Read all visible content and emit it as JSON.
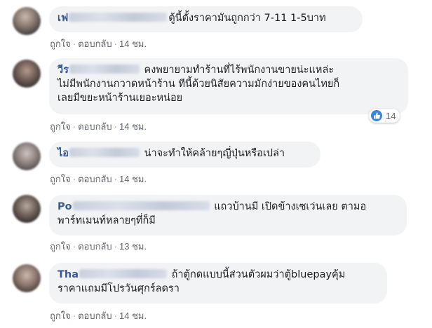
{
  "comments": [
    {
      "name_visible": "เฟ",
      "text_line1": "ตู้นี้ตั้งราคามันถูกกว่า 7-11 1-5บาท",
      "text_line2": "",
      "text_line3": "",
      "like": "ถูกใจ",
      "dot": "·",
      "reply": "ตอบกลับ",
      "time": "14 ชม."
    },
    {
      "name_visible": "วีร",
      "text_line1": "คงพยายามทำร้านที่ไร้พนักงานขายน่ะแหล่ะ",
      "text_line2": "ไม่มีพนักงานกวาดหน้าร้าน ทีนี้ด้วยนิสัยความมักง่ายของคนไทยก็",
      "text_line3": "เลยมีขยะหน้าร้านเยอะหน่อย",
      "like": "ถูกใจ",
      "dot": "·",
      "reply": "ตอบกลับ",
      "time": "14 ชม.",
      "reaction_count": "14",
      "reaction_icon": "thumbs-up-icon"
    },
    {
      "name_visible": "ไอ",
      "text_line1": "น่าจะทำให้คล้ายๆญี่ปุ่นหรือเปล่า",
      "text_line2": "",
      "text_line3": "",
      "like": "ถูกใจ",
      "dot": "·",
      "reply": "ตอบกลับ",
      "time": "14 ชม."
    },
    {
      "name_visible": "Po",
      "text_line1": "แถวบ้านมี เปิดข้างเซเว่นเลย ตามอ",
      "text_line2": "พาร์ทเมนท์หลายๆที่ก็มี",
      "text_line3": "",
      "like": "ถูกใจ",
      "dot": "·",
      "reply": "ตอบกลับ",
      "time": "13 ชม."
    },
    {
      "name_visible": "Tha",
      "text_line1": "ถ้าตู้กดแบบนี้ส่วนตัวผมว่าตู้bluepayคุ้ม",
      "text_line2": "ราคาแถมมีโปรวันศุกร์ลดรา",
      "text_line3": "",
      "like": "ถูกใจ",
      "dot": "·",
      "reply": "ตอบกลับ",
      "time": "14 ชม."
    }
  ],
  "colors": {
    "name": "#385898",
    "bubble": "#f2f3f5",
    "text": "#1c1e21",
    "meta": "#606770",
    "like_blue": "#3b83e0"
  }
}
